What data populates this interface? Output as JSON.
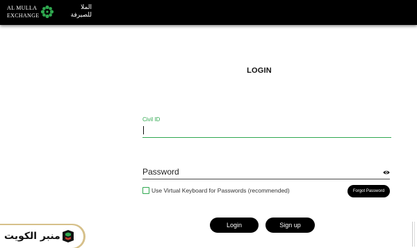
{
  "brand": {
    "name_en_line1": "AL MULLA",
    "name_en_line2": "EXCHANGE",
    "name_ar_line1": "الملا",
    "name_ar_line2": "للصيرفة",
    "logo_icon": "flower-logo-icon",
    "accent_color": "#2fa84f"
  },
  "login": {
    "title": "LOGIN",
    "civil_id_label": "Civil ID",
    "civil_id_value": "",
    "password_placeholder": "Password",
    "password_toggle_icon": "eye-icon",
    "virtual_keyboard_label": "Use Virtual Keyboard for Passwords (recommended)",
    "virtual_keyboard_checked": false,
    "forgot_password_label": "Forgot Password",
    "login_button_label": "Login",
    "signup_button_label": "Sign up"
  },
  "watermark": {
    "text": "منبر الكويت",
    "logo_icon": "kuwait-forum-logo-icon"
  }
}
